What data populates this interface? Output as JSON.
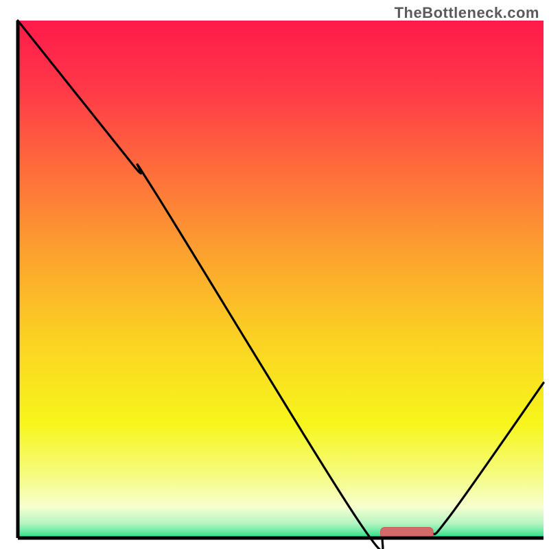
{
  "watermark": "TheBottleneck.com",
  "chart_data": {
    "type": "line",
    "title": "",
    "xlabel": "",
    "ylabel": "",
    "x_range": [
      0,
      100
    ],
    "y_range": [
      0,
      100
    ],
    "curve_approx": [
      {
        "x": 0,
        "y": 100
      },
      {
        "x": 22,
        "y": 72
      },
      {
        "x": 26,
        "y": 67
      },
      {
        "x": 65,
        "y": 3
      },
      {
        "x": 70,
        "y": 0.8
      },
      {
        "x": 78,
        "y": 0.8
      },
      {
        "x": 82,
        "y": 4
      },
      {
        "x": 100,
        "y": 30
      }
    ],
    "optimum_band": {
      "x_start": 69,
      "x_end": 79,
      "y": 1.0
    },
    "color_stops": [
      {
        "pos": 1.0,
        "color": "#ff1a4b"
      },
      {
        "pos": 0.87,
        "color": "#ff3848"
      },
      {
        "pos": 0.72,
        "color": "#fe6a3c"
      },
      {
        "pos": 0.55,
        "color": "#fca22f"
      },
      {
        "pos": 0.38,
        "color": "#fbd323"
      },
      {
        "pos": 0.22,
        "color": "#f7f61c"
      },
      {
        "pos": 0.12,
        "color": "#f5fc82"
      },
      {
        "pos": 0.06,
        "color": "#f6ffd0"
      },
      {
        "pos": 0.028,
        "color": "#b4f5c1"
      },
      {
        "pos": 0.01,
        "color": "#5de89c"
      },
      {
        "pos": 0.0,
        "color": "#1bdc82"
      }
    ],
    "note": "Axes are unlabeled in source; x and y treated as 0–100 percent. Curve is a single black line with a small red flat marker at the minimum."
  }
}
